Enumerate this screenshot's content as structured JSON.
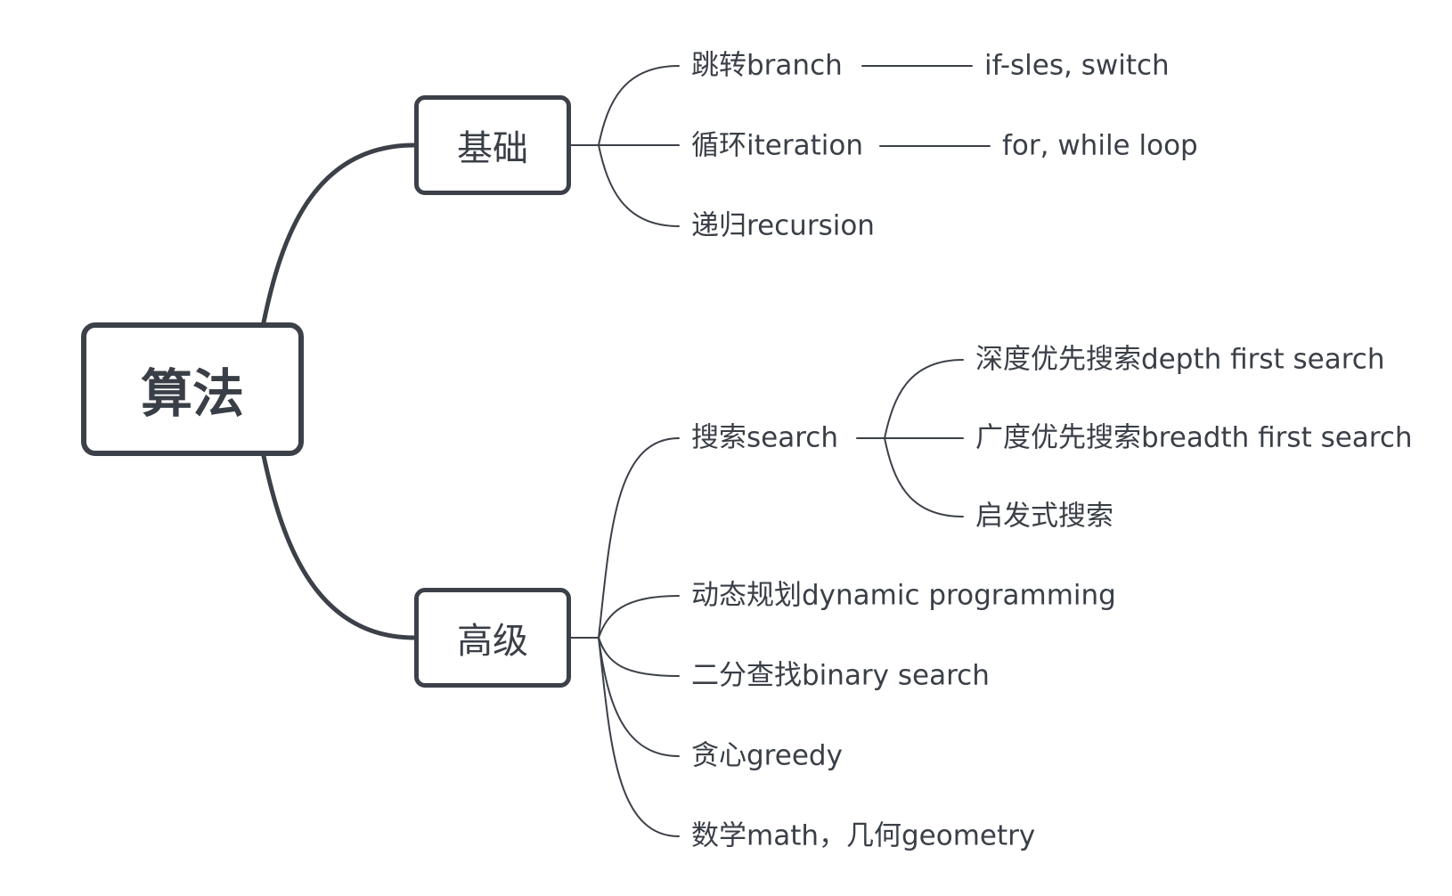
{
  "root": {
    "label": "算法"
  },
  "branches": [
    {
      "label": "基础",
      "children": [
        {
          "label": "跳转branch",
          "children": [
            {
              "label": "if-sles, switch"
            }
          ]
        },
        {
          "label": "循环iteration",
          "children": [
            {
              "label": "for, while loop"
            }
          ]
        },
        {
          "label": "递归recursion"
        }
      ]
    },
    {
      "label": "高级",
      "children": [
        {
          "label": "搜索search",
          "children": [
            {
              "label": "深度优先搜索depth first search"
            },
            {
              "label": "广度优先搜索breadth first search"
            },
            {
              "label": "启发式搜索"
            }
          ]
        },
        {
          "label": "动态规划dynamic programming"
        },
        {
          "label": "二分查找binary search"
        },
        {
          "label": "贪心greedy"
        },
        {
          "label": "数学math，几何geometry"
        }
      ]
    }
  ],
  "colors": {
    "node_border": "#3c4048",
    "connector": "#3c4048",
    "text": "#3a3f47",
    "background": "#ffffff"
  }
}
